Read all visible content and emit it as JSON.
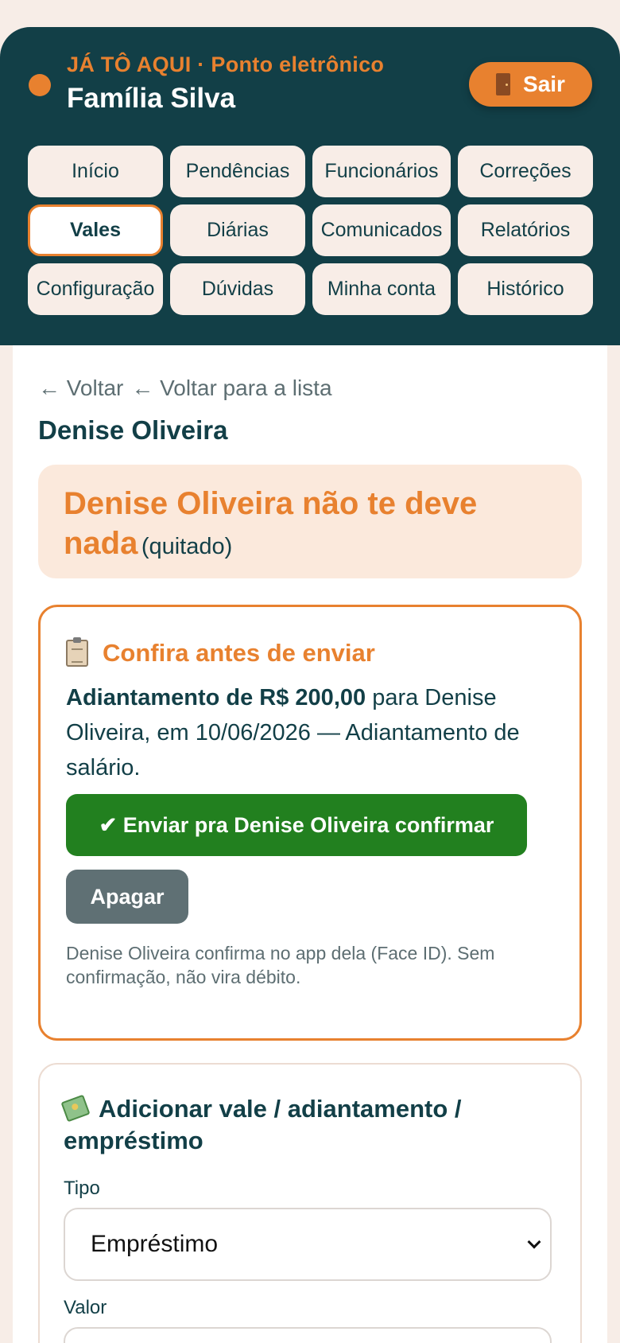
{
  "header": {
    "brand_subtitle": "JÁ TÔ AQUI · Ponto eletrônico",
    "family_name": "Família Silva",
    "logout_label": "Sair",
    "accent_color": "#e8812f",
    "background_color": "#123f47"
  },
  "nav": {
    "items": [
      {
        "label": "Início",
        "active": false
      },
      {
        "label": "Pendências",
        "active": false
      },
      {
        "label": "Funcionários",
        "active": false
      },
      {
        "label": "Correções",
        "active": false
      },
      {
        "label": "Vales",
        "active": true
      },
      {
        "label": "Diárias",
        "active": false
      },
      {
        "label": "Comunicados",
        "active": false
      },
      {
        "label": "Relatórios",
        "active": false
      },
      {
        "label": "Configuração",
        "active": false
      },
      {
        "label": "Dúvidas",
        "active": false
      },
      {
        "label": "Minha conta",
        "active": false
      },
      {
        "label": "Histórico",
        "active": false
      }
    ]
  },
  "breadcrumbs": {
    "back_label": "← Voltar",
    "back_to_list_label": "← Voltar para a lista"
  },
  "person": {
    "name": "Denise Oliveira"
  },
  "status": {
    "message": "Denise Oliveira não te deve nada",
    "note": "(quitado)"
  },
  "confirm": {
    "icon": "clipboard-icon",
    "title": "Confira antes de enviar",
    "summary_bold": "Adiantamento de R$ 200,00",
    "summary_rest": " para Denise Oliveira, em 10/06/2026 — Adiantamento de salário.",
    "send_label": "✔ Enviar pra Denise Oliveira confirmar",
    "delete_label": "Apagar",
    "help_text": "Denise Oliveira confirma no app dela (Face ID). Sem confirmação, não vira débito.",
    "send_color": "#22801f",
    "delete_color": "#5f7074"
  },
  "add_form": {
    "icon": "money-icon",
    "title": "Adicionar vale / adiantamento / empréstimo",
    "type_label": "Tipo",
    "type_value": "Empréstimo",
    "value_label": "Valor"
  }
}
